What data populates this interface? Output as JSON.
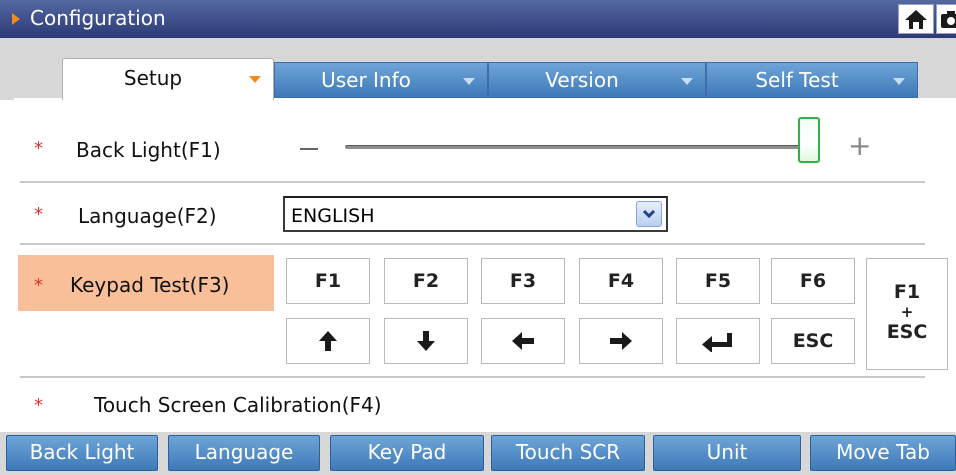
{
  "window": {
    "title": "Configuration",
    "home_icon": "home-icon",
    "camera_icon": "camera-icon"
  },
  "tabs": [
    {
      "label": "Setup",
      "active": true
    },
    {
      "label": "User Info",
      "active": false
    },
    {
      "label": "Version",
      "active": false
    },
    {
      "label": "Self Test",
      "active": false
    }
  ],
  "settings": {
    "required_marker": "*",
    "back_light": {
      "label": "Back Light(F1)",
      "minus": "−",
      "plus": "+",
      "level_percent": 100
    },
    "language": {
      "label": "Language(F2)",
      "value": "ENGLISH"
    },
    "keypad_test": {
      "label": "Keypad Test(F3)",
      "keys_row1": [
        "F1",
        "F2",
        "F3",
        "F4",
        "F5",
        "F6"
      ],
      "keys_row2_icons": [
        "arrow-up-icon",
        "arrow-down-icon",
        "arrow-left-icon",
        "arrow-right-icon",
        "enter-icon"
      ],
      "key_esc": "ESC",
      "combo_key": {
        "line1": "F1",
        "line2": "+",
        "line3": "ESC"
      }
    },
    "touch_screen": {
      "label": "Touch Screen Calibration(F4)"
    }
  },
  "bottom_buttons": [
    "Back Light",
    "Language",
    "Key Pad",
    "Touch SCR",
    "Unit",
    "Move Tab"
  ],
  "colors": {
    "title_bar": "#2b3a76",
    "accent_orange": "#f28a1c",
    "tab_blue": "#3e79b8",
    "keypad_highlight": "#f8bf98",
    "required_star": "#e0322e",
    "slider_thumb_border": "#2eb24a"
  }
}
